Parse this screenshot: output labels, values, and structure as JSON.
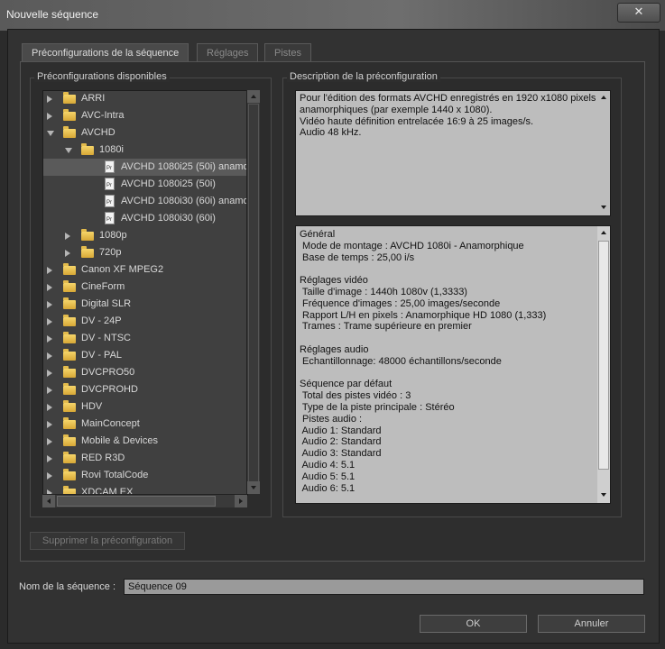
{
  "window": {
    "title": "Nouvelle séquence",
    "close_label": "✕"
  },
  "tabs": [
    {
      "label": "Préconfigurations de la séquence",
      "active": true
    },
    {
      "label": "Réglages",
      "active": false
    },
    {
      "label": "Pistes",
      "active": false
    }
  ],
  "presets": {
    "title": "Préconfigurations disponibles",
    "items": [
      {
        "label": "ARRI",
        "type": "folder",
        "level": 0,
        "expanded": false
      },
      {
        "label": "AVC-Intra",
        "type": "folder",
        "level": 0,
        "expanded": false
      },
      {
        "label": "AVCHD",
        "type": "folder",
        "level": 0,
        "expanded": true
      },
      {
        "label": "1080i",
        "type": "folder",
        "level": 1,
        "expanded": true
      },
      {
        "label": "AVCHD 1080i25 (50i) anamorphique",
        "type": "file",
        "level": 2,
        "selected": true
      },
      {
        "label": "AVCHD 1080i25 (50i)",
        "type": "file",
        "level": 2
      },
      {
        "label": "AVCHD 1080i30 (60i) anamorphique",
        "type": "file",
        "level": 2
      },
      {
        "label": "AVCHD 1080i30 (60i)",
        "type": "file",
        "level": 2
      },
      {
        "label": "1080p",
        "type": "folder",
        "level": 1,
        "expanded": false
      },
      {
        "label": "720p",
        "type": "folder",
        "level": 1,
        "expanded": false
      },
      {
        "label": "Canon XF MPEG2",
        "type": "folder",
        "level": 0,
        "expanded": false
      },
      {
        "label": "CineForm",
        "type": "folder",
        "level": 0,
        "expanded": false
      },
      {
        "label": "Digital SLR",
        "type": "folder",
        "level": 0,
        "expanded": false
      },
      {
        "label": "DV - 24P",
        "type": "folder",
        "level": 0,
        "expanded": false
      },
      {
        "label": "DV - NTSC",
        "type": "folder",
        "level": 0,
        "expanded": false
      },
      {
        "label": "DV - PAL",
        "type": "folder",
        "level": 0,
        "expanded": false
      },
      {
        "label": "DVCPRO50",
        "type": "folder",
        "level": 0,
        "expanded": false
      },
      {
        "label": "DVCPROHD",
        "type": "folder",
        "level": 0,
        "expanded": false
      },
      {
        "label": "HDV",
        "type": "folder",
        "level": 0,
        "expanded": false
      },
      {
        "label": "MainConcept",
        "type": "folder",
        "level": 0,
        "expanded": false
      },
      {
        "label": "Mobile & Devices",
        "type": "folder",
        "level": 0,
        "expanded": false
      },
      {
        "label": "RED R3D",
        "type": "folder",
        "level": 0,
        "expanded": false
      },
      {
        "label": "Rovi TotalCode",
        "type": "folder",
        "level": 0,
        "expanded": false
      },
      {
        "label": "XDCAM EX",
        "type": "folder",
        "level": 0,
        "expanded": false
      }
    ],
    "file_icon_text": "Pr",
    "delete_button": "Supprimer la préconfiguration"
  },
  "description": {
    "title": "Description de la préconfiguration",
    "summary_lines": [
      "Pour l'édition des formats AVCHD enregistrés en 1920 x1080 pixels",
      "anamorphiques (par exemple 1440 x 1080).",
      "Vidéo haute définition entrelacée 16:9 à 25 images/s.",
      "Audio 48 kHz."
    ],
    "details_lines": [
      "Général",
      " Mode de montage : AVCHD 1080i - Anamorphique",
      " Base de temps : 25,00 i/s",
      "",
      "Réglages vidéo",
      " Taille d'image : 1440h 1080v (1,3333)",
      " Fréquence d'images : 25,00 images/seconde",
      " Rapport L/H en pixels : Anamorphique HD 1080 (1,333)",
      " Trames : Trame supérieure en premier",
      "",
      "Réglages audio",
      " Echantillonnage: 48000 échantillons/seconde",
      "",
      "Séquence par défaut",
      " Total des pistes vidéo : 3",
      " Type de la piste principale : Stéréo",
      " Pistes audio :",
      " Audio 1: Standard",
      " Audio 2: Standard",
      " Audio 3: Standard",
      " Audio 4: 5.1",
      " Audio 5: 5.1",
      " Audio 6: 5.1"
    ]
  },
  "sequence_name": {
    "label": "Nom de la séquence :",
    "value": "Séquence 09"
  },
  "buttons": {
    "ok": "OK",
    "cancel": "Annuler"
  }
}
